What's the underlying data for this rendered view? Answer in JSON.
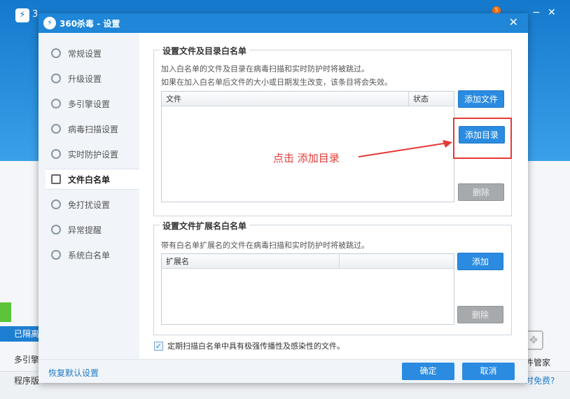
{
  "background": {
    "app_title": "3",
    "minimize": "−",
    "close": "✕",
    "badge": "5",
    "quarantine": "已隔离",
    "engines": "多引擎",
    "program": "程序版",
    "right_label": "件管家",
    "right_link": "时免费?"
  },
  "dialog": {
    "title": "360杀毒 - 设置",
    "close": "✕",
    "sidebar": [
      {
        "label": "常规设置"
      },
      {
        "label": "升级设置"
      },
      {
        "label": "多引擎设置"
      },
      {
        "label": "病毒扫描设置"
      },
      {
        "label": "实时防护设置"
      },
      {
        "label": "文件白名单"
      },
      {
        "label": "免打扰设置"
      },
      {
        "label": "异常提醒"
      },
      {
        "label": "系统白名单"
      }
    ],
    "file_section": {
      "title": "设置文件及目录白名单",
      "desc1": "加入白名单的文件及目录在病毒扫描和实时防护时将被跳过。",
      "desc2": "如果在加入白名单后文件的大小或日期发生改变，该条目将会失效。",
      "col_file": "文件",
      "col_status": "状态",
      "add_file": "添加文件",
      "add_dir": "添加目录",
      "delete": "删除"
    },
    "ext_section": {
      "title": "设置文件扩展名白名单",
      "desc": "带有白名单扩展名的文件在病毒扫描和实时防护时将被跳过。",
      "col_ext": "扩展名",
      "add": "添加",
      "delete": "删除"
    },
    "annotation": "点击 添加目录",
    "checkbox_label": "定期扫描白名单中具有极强传播性及感染性的文件。",
    "checkbox_checked": true,
    "restore": "恢复默认设置",
    "ok": "确定",
    "cancel": "取消"
  },
  "colors": {
    "accent": "#2a8be0",
    "annotation": "#e53935"
  }
}
